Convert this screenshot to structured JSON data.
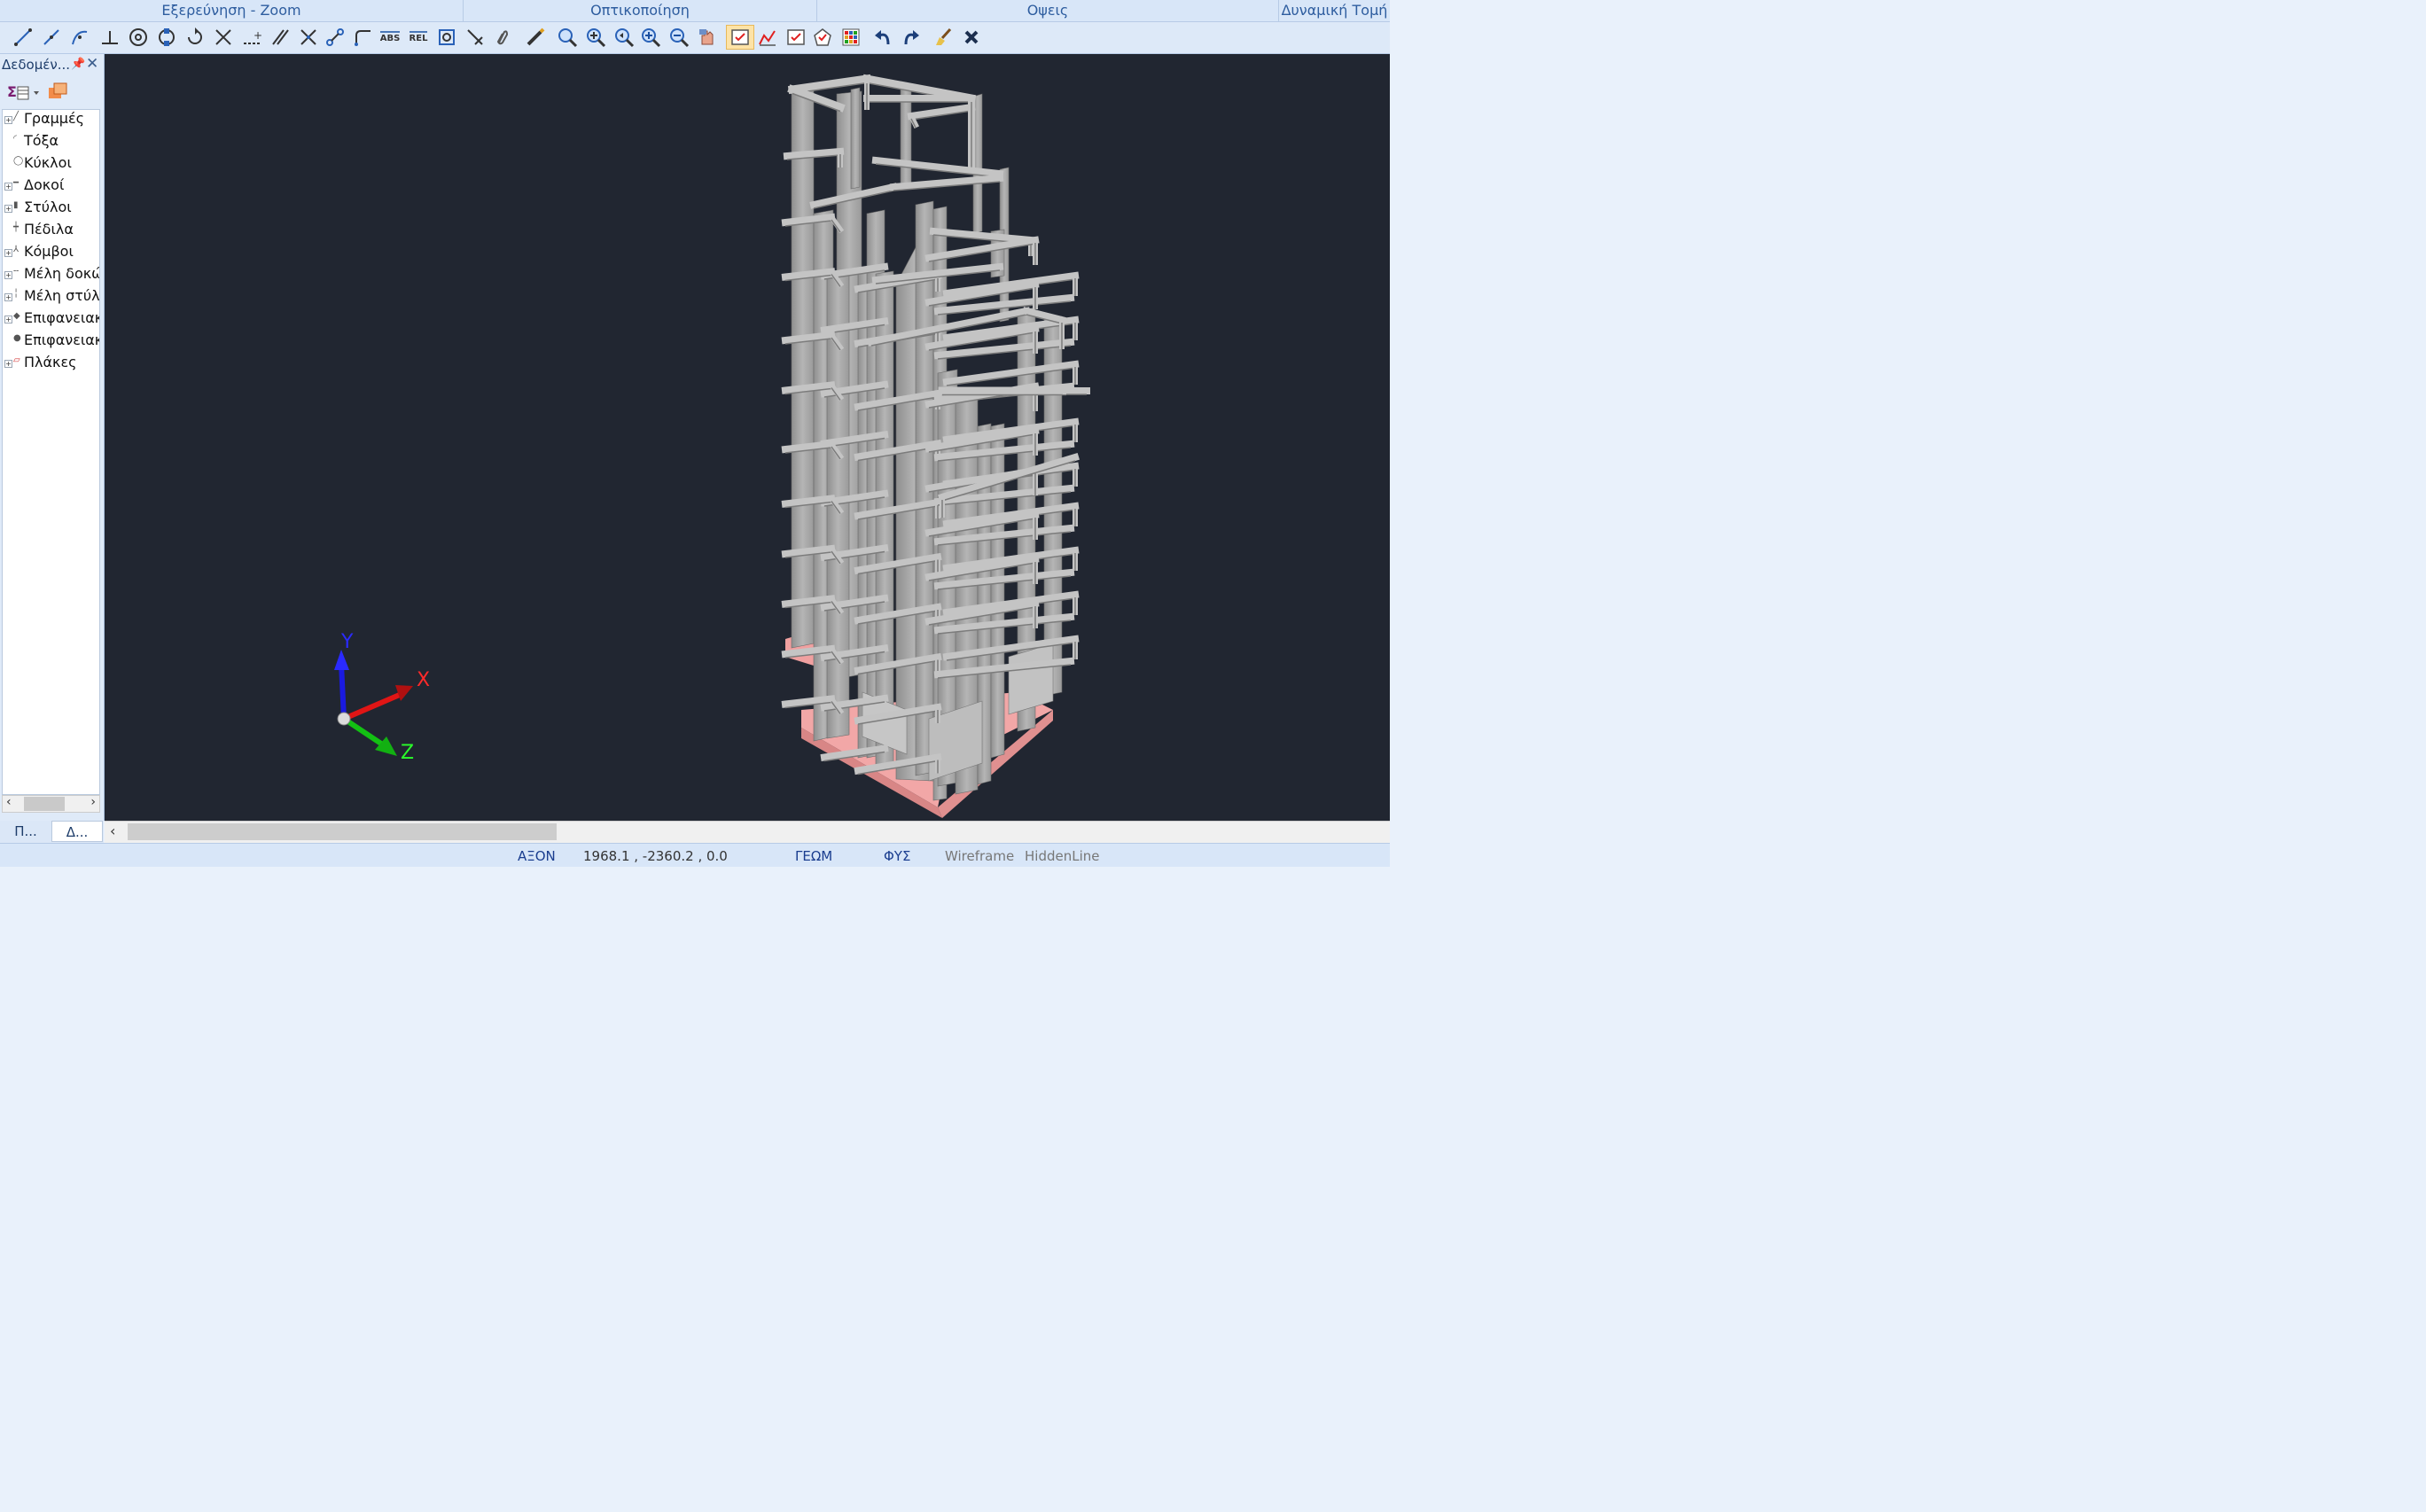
{
  "ribbon": {
    "groups": [
      "Εξερεύνηση - Zoom",
      "Οπτικοποίηση",
      "Οψεις",
      "Δυναμική Τομή"
    ]
  },
  "toolbar": {
    "abs_label": "ABS",
    "rel_label": "REL"
  },
  "left_panel": {
    "title": "Δεδομέν...",
    "close_glyph": "✕",
    "tree_items": [
      {
        "label": "Γραμμές",
        "icon": "line-icon",
        "expandable": true
      },
      {
        "label": "Τόξα",
        "icon": "arc-icon",
        "expandable": false
      },
      {
        "label": "Κύκλοι",
        "icon": "circle-icon",
        "expandable": false
      },
      {
        "label": "Δοκοί",
        "icon": "beam-icon",
        "expandable": true
      },
      {
        "label": "Στύλοι",
        "icon": "column-icon",
        "expandable": true
      },
      {
        "label": "Πέδιλα",
        "icon": "footing-icon",
        "expandable": false
      },
      {
        "label": "Κόμβοι",
        "icon": "node-icon",
        "expandable": true
      },
      {
        "label": "Μέλη δοκών",
        "icon": "beam-member-icon",
        "expandable": true
      },
      {
        "label": "Μέλη στύλων",
        "icon": "column-member-icon",
        "expandable": true
      },
      {
        "label": "Επιφανειακά",
        "icon": "surface-icon",
        "expandable": true
      },
      {
        "label": "Επιφανειακά",
        "icon": "surface-2-icon",
        "expandable": false
      },
      {
        "label": "Πλάκες",
        "icon": "slab-icon",
        "expandable": true
      }
    ],
    "bottom_tabs": [
      "Π...",
      "Δ..."
    ]
  },
  "viewport": {
    "axis_labels": {
      "x": "X",
      "y": "Y",
      "z": "Z"
    },
    "colors": {
      "background": "#212631",
      "structure": "#a9a9a9",
      "foundation": "#f2a3a3",
      "x_axis": "#e01010",
      "y_axis": "#1010d0",
      "z_axis": "#10c010"
    }
  },
  "statusbar": {
    "axon": "ΑΞΟΝ",
    "coords": "1968.1 , -2360.2 , 0.0",
    "geom": "ΓΕΩΜ",
    "fys": "ΦΥΣ",
    "wireframe": "Wireframe",
    "hiddenline": "HiddenLine"
  }
}
